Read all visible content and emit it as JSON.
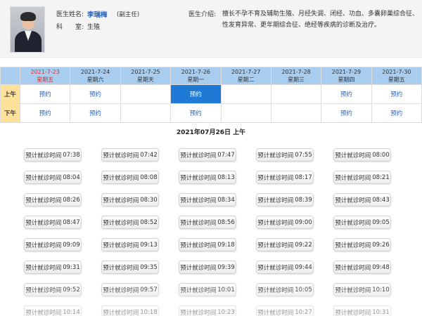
{
  "doctor": {
    "name_label": "医生姓名:",
    "name": "李瑞梅",
    "title": "(副主任)",
    "dept_label": "科　　室:",
    "dept": "生殖",
    "intro_label": "医生介绍:",
    "intro": "擅长不孕不育及辅助生殖、月经失调、闭经、功血、多囊卵巢综合征、性发育异常、更年期综合征、绝经等疾病的诊断及治疗。"
  },
  "schedule": {
    "days": [
      {
        "date": "2021-7-23",
        "weekday": "星期五",
        "today": true
      },
      {
        "date": "2021-7-24",
        "weekday": "星期六",
        "today": false
      },
      {
        "date": "2021-7-25",
        "weekday": "星期天",
        "today": false
      },
      {
        "date": "2021-7-26",
        "weekday": "星期一",
        "today": false
      },
      {
        "date": "2021-7-27",
        "weekday": "星期二",
        "today": false
      },
      {
        "date": "2021-7-28",
        "weekday": "星期三",
        "today": false
      },
      {
        "date": "2021-7-29",
        "weekday": "星期四",
        "today": false
      },
      {
        "date": "2021-7-30",
        "weekday": "星期五",
        "today": false
      }
    ],
    "rows": [
      {
        "period": "上午",
        "slots": [
          "预约",
          "预约",
          "",
          "预约",
          "",
          "",
          "预约",
          "预约"
        ],
        "selected_index": 3
      },
      {
        "period": "下午",
        "slots": [
          "预约",
          "预约",
          "",
          "预约",
          "",
          "",
          "预约",
          "预约"
        ],
        "selected_index": -1
      }
    ]
  },
  "selected_date": "2021年07月26日 上午",
  "time_label": "预计就诊时间",
  "times": [
    "07:38",
    "07:42",
    "07:47",
    "07:55",
    "08:00",
    "08:04",
    "08:08",
    "08:13",
    "08:17",
    "08:21",
    "08:26",
    "08:30",
    "08:34",
    "08:39",
    "08:43",
    "08:47",
    "08:52",
    "08:56",
    "09:00",
    "09:05",
    "09:09",
    "09:13",
    "09:18",
    "09:22",
    "09:26",
    "09:31",
    "09:35",
    "09:39",
    "09:44",
    "09:48",
    "09:52",
    "09:57",
    "10:01",
    "10:05",
    "10:10",
    "10:14",
    "10:18",
    "10:23",
    "10:27",
    "10:31"
  ],
  "colors": {
    "header_blue": "#a8cdef",
    "period_yellow": "#ffe29a",
    "link_blue": "#1f5fbf",
    "selected_blue": "#1f7ad6",
    "today_red": "#d83030"
  }
}
